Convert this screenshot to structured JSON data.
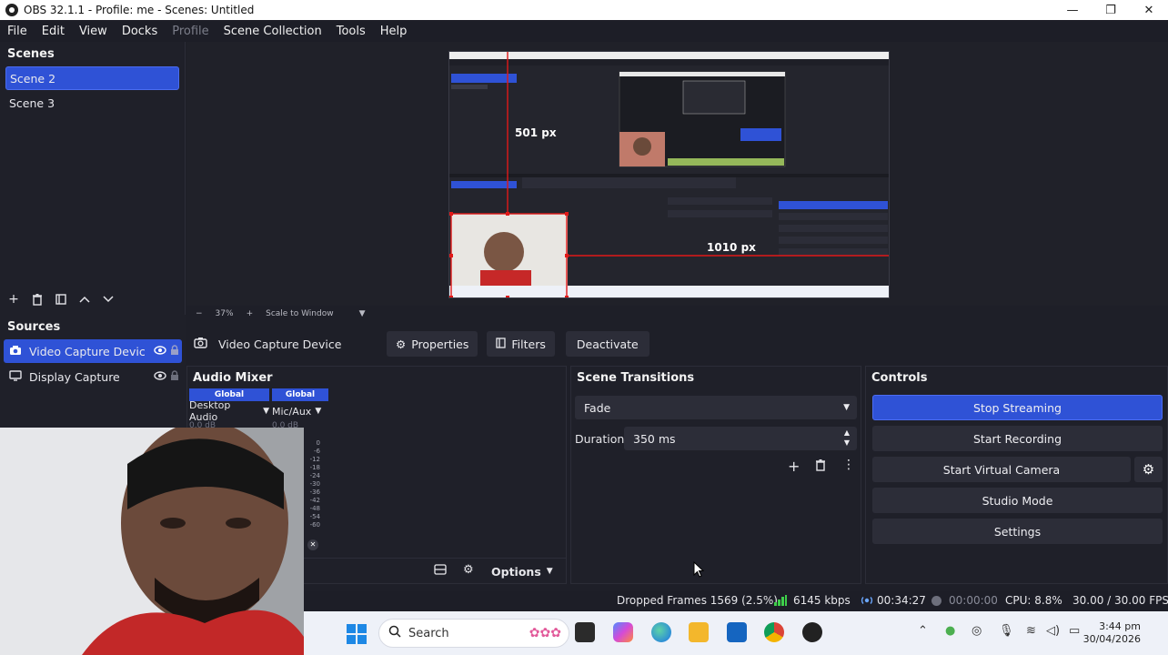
{
  "window": {
    "title": "OBS 32.1.1 - Profile: me - Scenes: Untitled",
    "controls": [
      "—",
      "❐",
      "✕"
    ]
  },
  "menu": [
    "File",
    "Edit",
    "View",
    "Docks",
    "Profile",
    "Scene Collection",
    "Tools",
    "Help"
  ],
  "scenes": {
    "title": "Scenes",
    "items": [
      "Scene 2",
      "Scene 3"
    ],
    "selected": "Scene 2"
  },
  "preview": {
    "overlay_height": "501 px",
    "overlay_width": "1010 px",
    "zoom": "37%",
    "scale_mode": "Scale to Window"
  },
  "sources": {
    "title": "Sources",
    "items": [
      "Video Capture Devic",
      "Display Capture"
    ],
    "selected": "Video Capture Devic"
  },
  "source_toolbar": {
    "source_name": "Video Capture Device",
    "properties": "Properties",
    "filters": "Filters",
    "deactivate": "Deactivate"
  },
  "audio_mixer": {
    "title": "Audio Mixer",
    "channels": [
      {
        "badge": "Global",
        "name": "Desktop Audio",
        "level": "0.0 dB"
      },
      {
        "badge": "Global",
        "name": "Mic/Aux",
        "level": "0.0 dB"
      }
    ],
    "scale": [
      "0",
      "-6",
      "-12",
      "-18",
      "-24",
      "-30",
      "-36",
      "-42",
      "-48",
      "-54",
      "-60"
    ],
    "options": "Options"
  },
  "scene_transitions": {
    "title": "Scene Transitions",
    "transition": "Fade",
    "duration_label": "Duration",
    "duration_value": "350 ms"
  },
  "controls": {
    "title": "Controls",
    "stop_streaming": "Stop Streaming",
    "start_recording": "Start Recording",
    "start_virtual_camera": "Start Virtual Camera",
    "studio_mode": "Studio Mode",
    "settings": "Settings"
  },
  "status": {
    "dropped_frames": "Dropped Frames 1569 (2.5%)",
    "bitrate": "6145 kbps",
    "stream_time": "00:34:27",
    "rec_time": "00:00:00",
    "cpu": "CPU: 8.8%",
    "fps": "30.00 / 30.00 FPS"
  },
  "taskbar": {
    "search_placeholder": "Search",
    "time": "3:44 pm",
    "date": "30/04/2026"
  },
  "colors": {
    "accent": "#2f52d6",
    "panel": "#1f2029",
    "background": "#1e1f28",
    "button": "#2c2d38",
    "bitrate_green": "#3ecf4a",
    "red_guides": "#e01818"
  }
}
